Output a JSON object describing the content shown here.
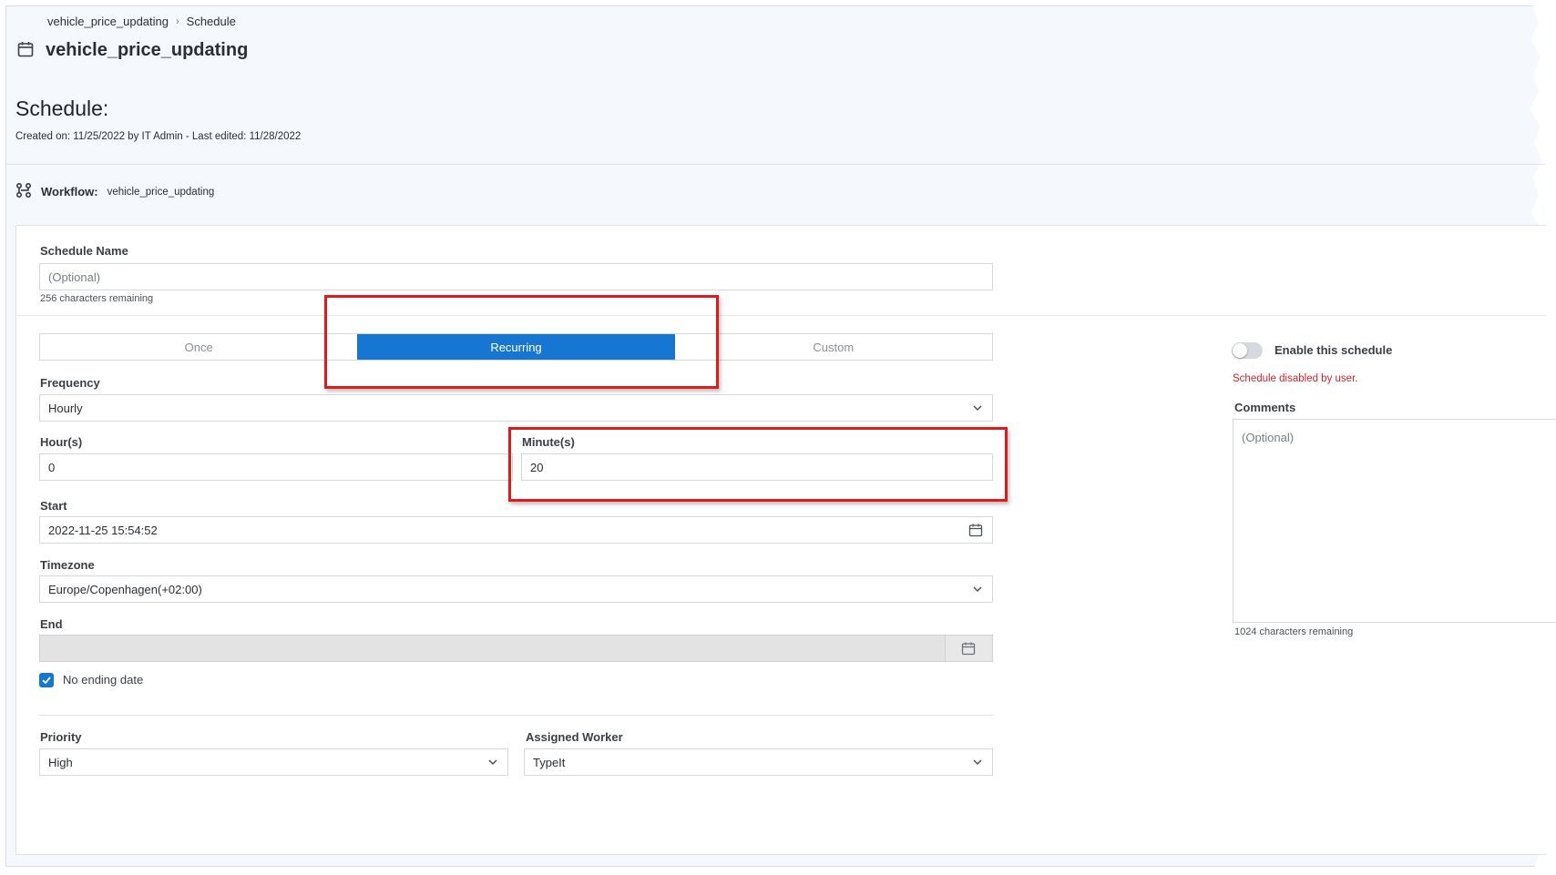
{
  "breadcrumb": {
    "parent": "vehicle_price_updating",
    "separator": "›",
    "current": "Schedule"
  },
  "header": {
    "title": "vehicle_price_updating",
    "icon": "calendar-icon"
  },
  "schedule_heading": "Schedule:",
  "meta_text": "Created on: 11/25/2022 by IT Admin - Last edited: 11/28/2022",
  "workflow": {
    "label": "Workflow:",
    "value": "vehicle_price_updating",
    "icon": "workflow-icon"
  },
  "form": {
    "schedule_name": {
      "label": "Schedule Name",
      "placeholder": "(Optional)",
      "note": "256 characters remaining"
    },
    "modes": [
      "Once",
      "Recurring",
      "Custom"
    ],
    "active_mode": "Recurring",
    "frequency": {
      "label": "Frequency",
      "value": "Hourly"
    },
    "hours": {
      "label": "Hour(s)",
      "value": "0"
    },
    "minutes": {
      "label": "Minute(s)",
      "value": "20"
    },
    "start": {
      "label": "Start",
      "value": "2022-11-25 15:54:52"
    },
    "timezone": {
      "label": "Timezone",
      "value": "Europe/Copenhagen(+02:00)"
    },
    "end": {
      "label": "End",
      "value": ""
    },
    "no_ending_date": {
      "label": "No ending date",
      "checked": true
    },
    "priority": {
      "label": "Priority",
      "value": "High"
    },
    "assigned_worker": {
      "label": "Assigned Worker",
      "value": "TypeIt"
    }
  },
  "side": {
    "enable_label": "Enable this schedule",
    "enabled": false,
    "status_text": "Schedule disabled by user.",
    "status_color": "#d0242b",
    "comments_label": "Comments",
    "comments_placeholder": "(Optional)",
    "comments_note": "1024 characters remaining"
  },
  "colors": {
    "accent": "#1676d2",
    "highlight_box": "#e0191b"
  }
}
